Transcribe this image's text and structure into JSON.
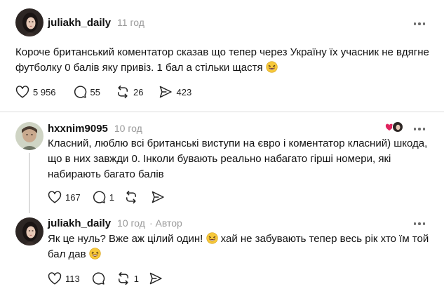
{
  "posts": [
    {
      "username": "juliakh_daily",
      "time": "11 год",
      "text_line1": "Короче британський коментатор сказав що тепер через Україну їх учасник не вдягне",
      "text_line2": "футболку 0 балів яку привіз. 1 бал а стільки щастя",
      "likes": "5 956",
      "replies": "55",
      "reposts": "26",
      "shares": "423"
    },
    {
      "username": "hxxnim9095",
      "time": "10 год",
      "text_line1": "Класний, люблю всі британські виступи на євро і коментатор класний) шкода,",
      "text_line2": "що в них завжди 0. Інколи бувають реально набагато гірші номери, які",
      "text_line3": "набирають багато балів",
      "likes": "167",
      "replies": "1"
    },
    {
      "username": "juliakh_daily",
      "time": "10 год",
      "author_tag": "· Автор",
      "text_line1a": "Як це нуль? Вже аж цілий один!",
      "text_line1b": "хай не забувають тепер весь рік хто їм той",
      "text_line2": "бал дав",
      "likes": "113",
      "reposts": "1"
    }
  ],
  "icons": [
    "heart-icon",
    "comment-icon",
    "repost-icon",
    "share-icon",
    "more-icon",
    "laughing-emoji"
  ],
  "colors": {
    "liked_heart": "#e0245e",
    "muted_text": "#9a9a9a",
    "divider": "#dedede"
  }
}
